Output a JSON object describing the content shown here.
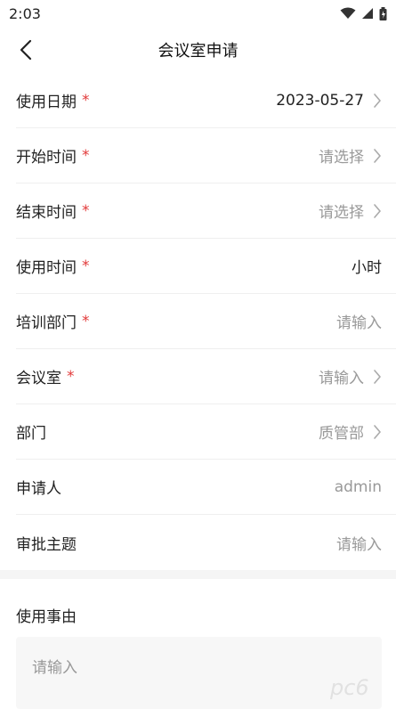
{
  "status_bar": {
    "time": "2:03",
    "icons": [
      "wifi-icon",
      "signal-icon",
      "battery-icon"
    ]
  },
  "nav": {
    "title": "会议室申请",
    "back_icon": "chevron-left-icon"
  },
  "form": {
    "rows": [
      {
        "label": "使用日期",
        "required": "*",
        "value": "2023-05-27",
        "value_style": "strong",
        "chevron": true
      },
      {
        "label": "开始时间",
        "required": "*",
        "value": "请选择",
        "value_style": "muted",
        "chevron": true
      },
      {
        "label": "结束时间",
        "required": "*",
        "value": "请选择",
        "value_style": "muted",
        "chevron": true
      },
      {
        "label": "使用时间",
        "required": "*",
        "value": "小时",
        "value_style": "strong",
        "chevron": false
      },
      {
        "label": "培训部门",
        "required": "*",
        "value": "请输入",
        "value_style": "muted",
        "chevron": false
      },
      {
        "label": "会议室",
        "required": "*",
        "value": "请输入",
        "value_style": "muted",
        "chevron": true
      },
      {
        "label": "部门",
        "required": "",
        "value": "质管部",
        "value_style": "muted",
        "chevron": true
      },
      {
        "label": "申请人",
        "required": "",
        "value": "admin",
        "value_style": "muted",
        "chevron": false
      },
      {
        "label": "审批主题",
        "required": "",
        "value": "请输入",
        "value_style": "muted",
        "chevron": false
      }
    ]
  },
  "reason": {
    "label": "使用事由",
    "placeholder": "请输入"
  },
  "colors": {
    "required": "#e23a3a",
    "muted_text": "#999999",
    "divider": "#efefef"
  },
  "watermark_text": "pc6"
}
